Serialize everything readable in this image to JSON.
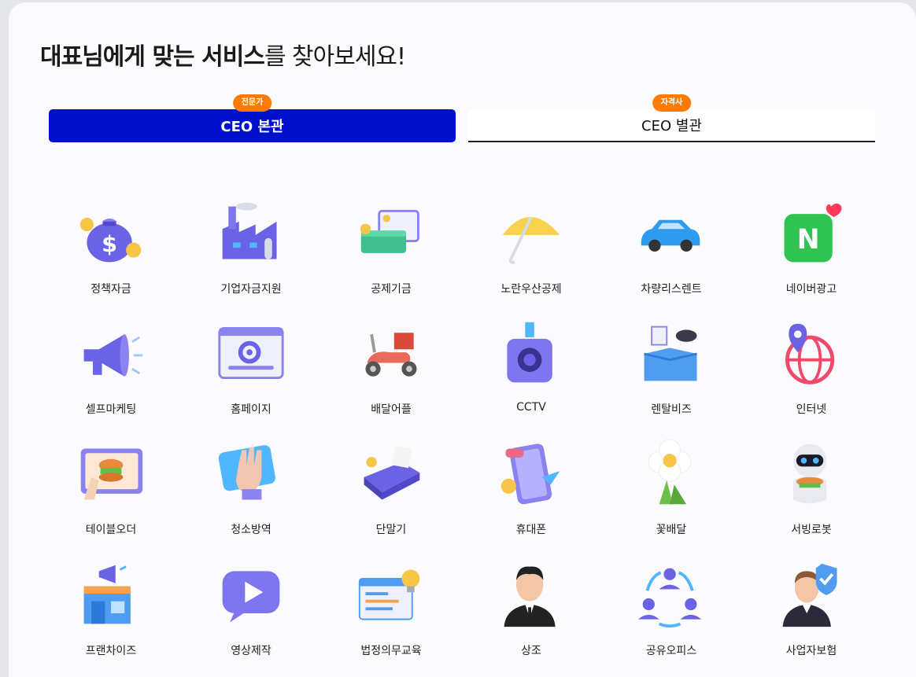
{
  "title": {
    "strong": "대표님에게 맞는 서비스",
    "light": "를 찾아보세요!"
  },
  "tabs": [
    {
      "label": "CEO 본관",
      "badge": "전문가"
    },
    {
      "label": "CEO 별관",
      "badge": "자격사"
    }
  ],
  "services": [
    {
      "label": "정책자금",
      "icon": "money-bag-icon"
    },
    {
      "label": "기업자금지원",
      "icon": "factory-icon"
    },
    {
      "label": "공제기금",
      "icon": "cash-stack-icon"
    },
    {
      "label": "노란우산공제",
      "icon": "umbrella-icon"
    },
    {
      "label": "차량리스렌트",
      "icon": "car-icon"
    },
    {
      "label": "네이버광고",
      "icon": "naver-icon"
    },
    {
      "label": "셀프마케팅",
      "icon": "megaphone-icon"
    },
    {
      "label": "홈페이지",
      "icon": "browser-gear-icon"
    },
    {
      "label": "배달어플",
      "icon": "scooter-icon"
    },
    {
      "label": "CCTV",
      "icon": "cctv-icon"
    },
    {
      "label": "렌탈비즈",
      "icon": "box-icon"
    },
    {
      "label": "인터넷",
      "icon": "globe-pin-icon"
    },
    {
      "label": "테이블오더",
      "icon": "tablet-order-icon"
    },
    {
      "label": "청소방역",
      "icon": "cleaning-glove-icon"
    },
    {
      "label": "단말기",
      "icon": "card-terminal-icon"
    },
    {
      "label": "휴대폰",
      "icon": "phone-icon"
    },
    {
      "label": "꽃배달",
      "icon": "flower-icon"
    },
    {
      "label": "서빙로봇",
      "icon": "robot-icon"
    },
    {
      "label": "프랜차이즈",
      "icon": "store-icon"
    },
    {
      "label": "영상제작",
      "icon": "play-icon"
    },
    {
      "label": "법정의무교육",
      "icon": "education-icon"
    },
    {
      "label": "상조",
      "icon": "suit-man-icon"
    },
    {
      "label": "공유오피스",
      "icon": "people-share-icon"
    },
    {
      "label": "사업자보험",
      "icon": "insurance-shield-icon"
    }
  ]
}
